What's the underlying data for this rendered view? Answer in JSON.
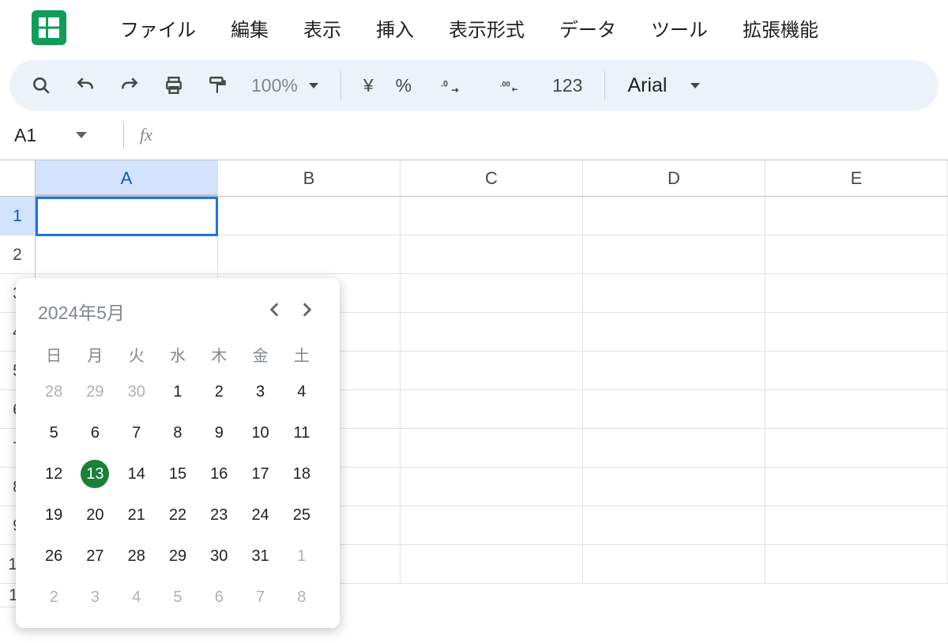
{
  "menu": {
    "items": [
      "ファイル",
      "編集",
      "表示",
      "挿入",
      "表示形式",
      "データ",
      "ツール",
      "拡張機能"
    ]
  },
  "toolbar": {
    "zoom": "100%",
    "currency": "¥",
    "percent": "%",
    "num123": "123",
    "font": "Arial"
  },
  "formula": {
    "cell_ref": "A1",
    "fx": "fx"
  },
  "columns": [
    "A",
    "B",
    "C",
    "D",
    "E"
  ],
  "rows_visible_first": "1",
  "rows_visible_last": "11",
  "datepicker": {
    "title": "2024年5月",
    "weekdays": [
      "日",
      "月",
      "火",
      "水",
      "木",
      "金",
      "土"
    ],
    "weeks": [
      [
        {
          "d": "28",
          "m": true
        },
        {
          "d": "29",
          "m": true
        },
        {
          "d": "30",
          "m": true
        },
        {
          "d": "1"
        },
        {
          "d": "2"
        },
        {
          "d": "3"
        },
        {
          "d": "4"
        }
      ],
      [
        {
          "d": "5"
        },
        {
          "d": "6"
        },
        {
          "d": "7"
        },
        {
          "d": "8"
        },
        {
          "d": "9"
        },
        {
          "d": "10"
        },
        {
          "d": "11"
        }
      ],
      [
        {
          "d": "12"
        },
        {
          "d": "13",
          "today": true
        },
        {
          "d": "14"
        },
        {
          "d": "15"
        },
        {
          "d": "16"
        },
        {
          "d": "17"
        },
        {
          "d": "18"
        }
      ],
      [
        {
          "d": "19"
        },
        {
          "d": "20"
        },
        {
          "d": "21"
        },
        {
          "d": "22"
        },
        {
          "d": "23"
        },
        {
          "d": "24"
        },
        {
          "d": "25"
        }
      ],
      [
        {
          "d": "26"
        },
        {
          "d": "27"
        },
        {
          "d": "28"
        },
        {
          "d": "29"
        },
        {
          "d": "30"
        },
        {
          "d": "31"
        },
        {
          "d": "1",
          "m": true
        }
      ],
      [
        {
          "d": "2",
          "m": true
        },
        {
          "d": "3",
          "m": true
        },
        {
          "d": "4",
          "m": true
        },
        {
          "d": "5",
          "m": true
        },
        {
          "d": "6",
          "m": true
        },
        {
          "d": "7",
          "m": true
        },
        {
          "d": "8",
          "m": true
        }
      ]
    ]
  }
}
